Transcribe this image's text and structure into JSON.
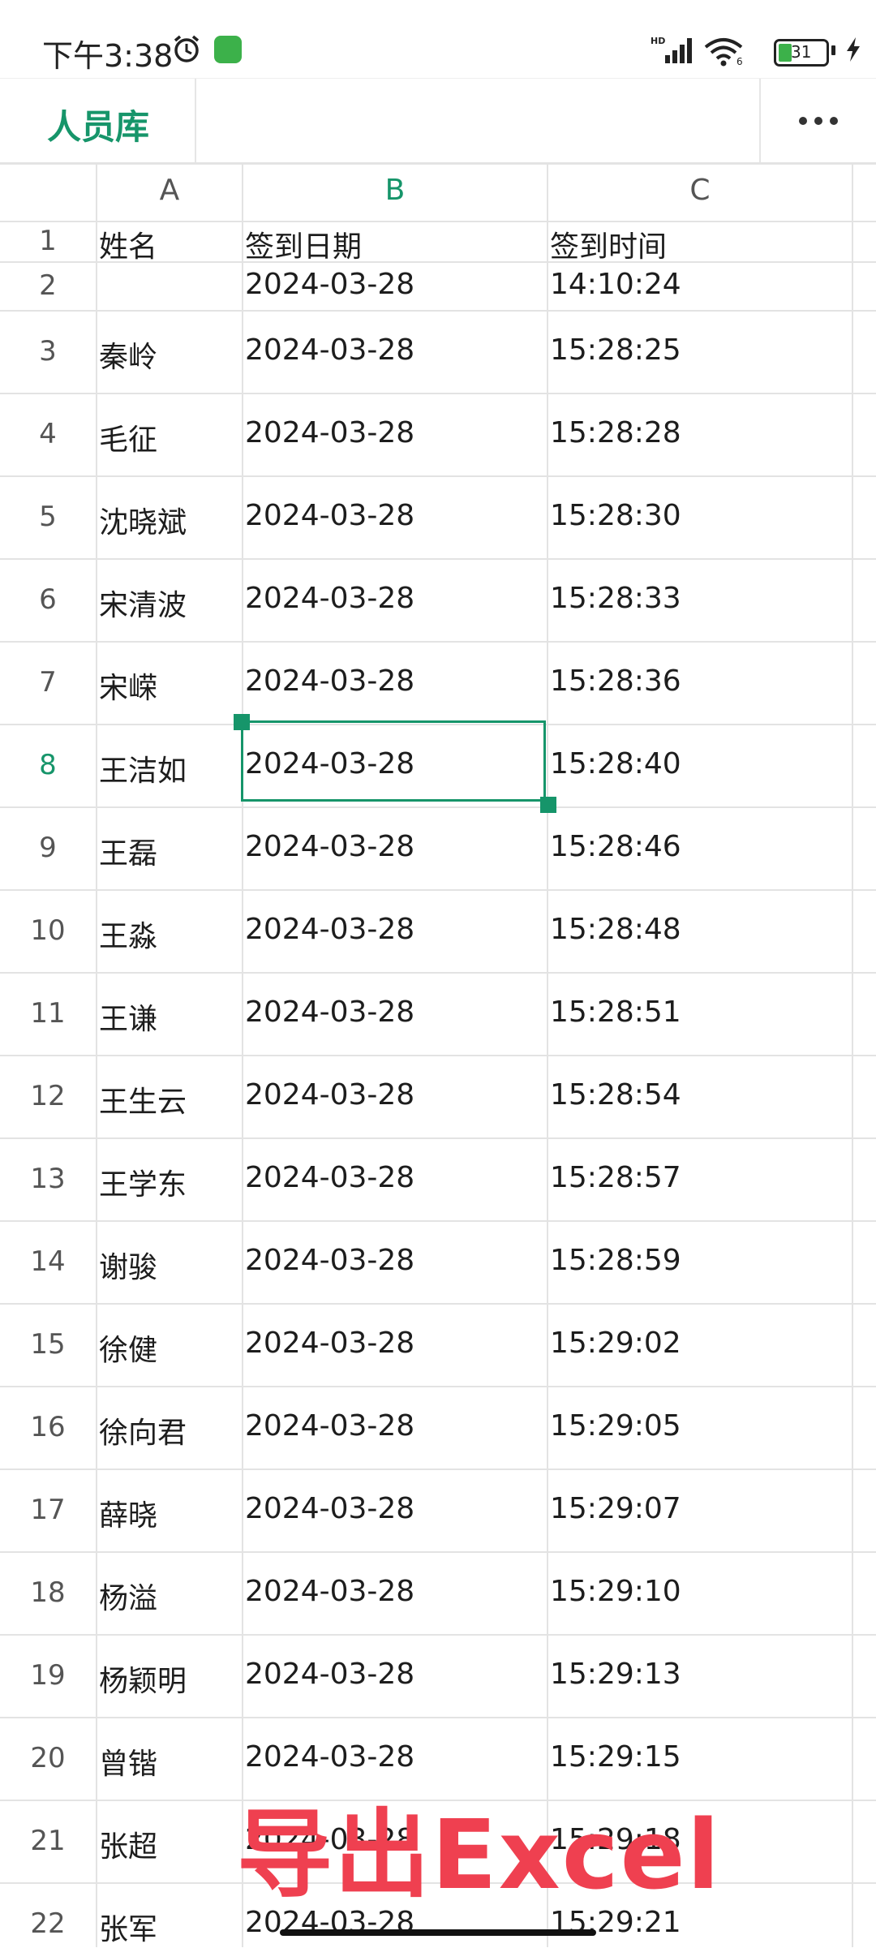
{
  "status_bar": {
    "time": "下午3:38",
    "battery": "31",
    "network": "HD"
  },
  "header": {
    "title": "人员库"
  },
  "columns": [
    "A",
    "B",
    "C"
  ],
  "active_column": "B",
  "active_row": "8",
  "rows": [
    {
      "num": "1",
      "name": "姓名",
      "date": "签到日期",
      "time": "签到时间"
    },
    {
      "num": "2",
      "name": "",
      "date": "2024-03-28",
      "time": "14:10:24"
    },
    {
      "num": "3",
      "name": "秦岭",
      "date": "2024-03-28",
      "time": "15:28:25"
    },
    {
      "num": "4",
      "name": "毛征",
      "date": "2024-03-28",
      "time": "15:28:28"
    },
    {
      "num": "5",
      "name": "沈晓斌",
      "date": "2024-03-28",
      "time": "15:28:30"
    },
    {
      "num": "6",
      "name": "宋清波",
      "date": "2024-03-28",
      "time": "15:28:33"
    },
    {
      "num": "7",
      "name": "宋嵘",
      "date": "2024-03-28",
      "time": "15:28:36"
    },
    {
      "num": "8",
      "name": "王洁如",
      "date": "2024-03-28",
      "time": "15:28:40"
    },
    {
      "num": "9",
      "name": "王磊",
      "date": "2024-03-28",
      "time": "15:28:46"
    },
    {
      "num": "10",
      "name": "王淼",
      "date": "2024-03-28",
      "time": "15:28:48"
    },
    {
      "num": "11",
      "name": "王谦",
      "date": "2024-03-28",
      "time": "15:28:51"
    },
    {
      "num": "12",
      "name": "王生云",
      "date": "2024-03-28",
      "time": "15:28:54"
    },
    {
      "num": "13",
      "name": "王学东",
      "date": "2024-03-28",
      "time": "15:28:57"
    },
    {
      "num": "14",
      "name": "谢骏",
      "date": "2024-03-28",
      "time": "15:28:59"
    },
    {
      "num": "15",
      "name": "徐健",
      "date": "2024-03-28",
      "time": "15:29:02"
    },
    {
      "num": "16",
      "name": "徐向君",
      "date": "2024-03-28",
      "time": "15:29:05"
    },
    {
      "num": "17",
      "name": "薛晓",
      "date": "2024-03-28",
      "time": "15:29:07"
    },
    {
      "num": "18",
      "name": "杨溢",
      "date": "2024-03-28",
      "time": "15:29:10"
    },
    {
      "num": "19",
      "name": "杨颖明",
      "date": "2024-03-28",
      "time": "15:29:13"
    },
    {
      "num": "20",
      "name": "曾锴",
      "date": "2024-03-28",
      "time": "15:29:15"
    },
    {
      "num": "21",
      "name": "张超",
      "date": "2024-03-28",
      "time": "15:29:18"
    },
    {
      "num": "22",
      "name": "张军",
      "date": "2024-03-28",
      "time": "15:29:21"
    }
  ],
  "overlay_text": "导出Excel"
}
